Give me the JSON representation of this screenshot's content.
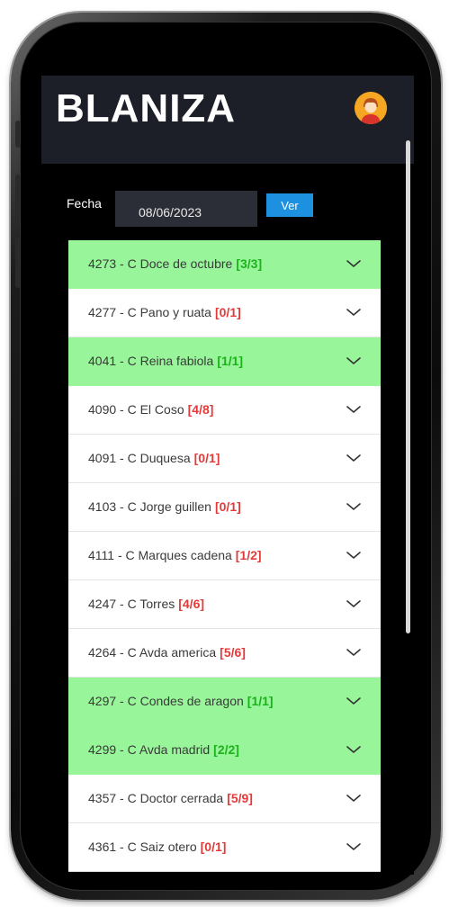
{
  "header": {
    "brand": "BLANIZA",
    "avatar_icon": "user-avatar-icon"
  },
  "filter": {
    "date_label": "Fecha",
    "date_value": "08/06/2023",
    "submit_label": "Ver"
  },
  "colors": {
    "header_bg": "#1c1f28",
    "done_bg": "#98f59a",
    "done_count": "#1bb21b",
    "pending_count": "#e23b3b",
    "button_bg": "#1e90e0"
  },
  "items": [
    {
      "code": "4273",
      "street": "C Doce de octubre",
      "count": "[3/3]",
      "status": "done"
    },
    {
      "code": "4277",
      "street": "C Pano y ruata",
      "count": "[0/1]",
      "status": "pending"
    },
    {
      "code": "4041",
      "street": "C Reina fabiola",
      "count": "[1/1]",
      "status": "done"
    },
    {
      "code": "4090",
      "street": "C El Coso",
      "count": "[4/8]",
      "status": "pending"
    },
    {
      "code": "4091",
      "street": "C Duquesa",
      "count": "[0/1]",
      "status": "pending"
    },
    {
      "code": "4103",
      "street": "C Jorge guillen",
      "count": "[0/1]",
      "status": "pending"
    },
    {
      "code": "4111",
      "street": "C Marques cadena",
      "count": "[1/2]",
      "status": "pending"
    },
    {
      "code": "4247",
      "street": "C Torres",
      "count": "[4/6]",
      "status": "pending"
    },
    {
      "code": "4264",
      "street": "C Avda america",
      "count": "[5/6]",
      "status": "pending"
    },
    {
      "code": "4297",
      "street": "C Condes de aragon",
      "count": "[1/1]",
      "status": "done"
    },
    {
      "code": "4299",
      "street": "C Avda madrid",
      "count": "[2/2]",
      "status": "done"
    },
    {
      "code": "4357",
      "street": "C Doctor cerrada",
      "count": "[5/9]",
      "status": "pending"
    },
    {
      "code": "4361",
      "street": "C Saiz otero",
      "count": "[0/1]",
      "status": "pending"
    }
  ]
}
